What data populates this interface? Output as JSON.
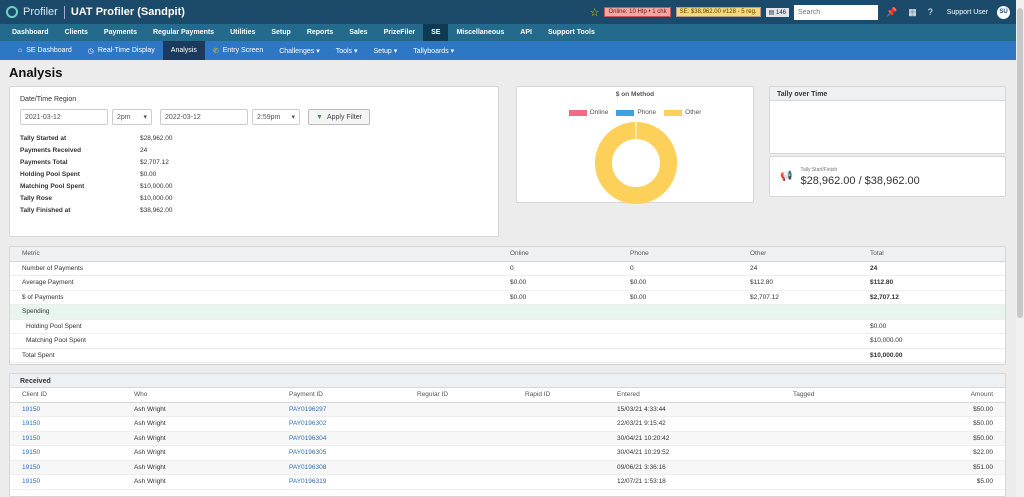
{
  "topbar": {
    "brand": "Profiler",
    "app_title": "UAT Profiler (Sandpit)",
    "online_badge": "Online: 10 Htp • 1 chk",
    "se_badge": "SE: $38,962.00 #128 - 5 reg.",
    "count_badge": "146",
    "search_placeholder": "Search",
    "user_name": "Support User",
    "user_initials": "SU"
  },
  "main_nav": [
    {
      "label": "Dashboard"
    },
    {
      "label": "Clients"
    },
    {
      "label": "Payments"
    },
    {
      "label": "Regular Payments"
    },
    {
      "label": "Utilities"
    },
    {
      "label": "Setup"
    },
    {
      "label": "Reports"
    },
    {
      "label": "Sales"
    },
    {
      "label": "PrizeFiler"
    },
    {
      "label": "SE"
    },
    {
      "label": "Miscellaneous"
    },
    {
      "label": "API"
    },
    {
      "label": "Support Tools"
    }
  ],
  "sub_nav": {
    "se_dashboard": "SE Dashboard",
    "realtime": "Real-Time Display",
    "analysis": "Analysis",
    "entry": "Entry Screen",
    "challenges": "Challenges ▾",
    "tools": "Tools ▾",
    "setup": "Setup ▾",
    "tallyboards": "Tallyboards ▾"
  },
  "page_title": "Analysis",
  "filter": {
    "title": "Date/Time Region",
    "start_date": "2021-03-12",
    "start_time": "2pm",
    "end_date": "2022-03-12",
    "end_time": "2:59pm",
    "apply_label": "Apply Filter"
  },
  "stats": [
    {
      "label": "Tally Started at",
      "value": "$28,962.00"
    },
    {
      "label": "Payments Received",
      "value": "24"
    },
    {
      "label": "Payments Total",
      "value": "$2,707.12"
    },
    {
      "label": "Holding Pool Spent",
      "value": "$0.00"
    },
    {
      "label": "Matching Pool Spent",
      "value": "$10,000.00"
    },
    {
      "label": "Tally Rose",
      "value": "$10,000.00"
    },
    {
      "label": "Tally Finished at",
      "value": "$38,962.00"
    }
  ],
  "chart_data": {
    "type": "pie",
    "title": "$ on Method",
    "categories": [
      "Online",
      "Phone",
      "Other"
    ],
    "values": [
      0,
      0,
      2707.12
    ],
    "colors": [
      "#f06c84",
      "#3ea0e0",
      "#fdd05a"
    ],
    "legend": "top"
  },
  "tally_over_time": {
    "title": "Tally over Time"
  },
  "start_finish": {
    "label": "Tally Start/Finish",
    "value": "$28,962.00 / $38,962.00"
  },
  "metrics": {
    "headers": [
      "Metric",
      "Online",
      "Phone",
      "Other",
      "Total"
    ],
    "rows": [
      [
        "Number of Payments",
        "0",
        "0",
        "24",
        "24"
      ],
      [
        "Average Payment",
        "$0.00",
        "$0.00",
        "$112.80",
        "$112.80"
      ],
      [
        "$ of Payments",
        "$0.00",
        "$0.00",
        "$2,707.12",
        "$2,707.12"
      ]
    ],
    "spending_label": "Spending",
    "spending_rows": [
      [
        "Holding Pool Spent",
        "$0.00"
      ],
      [
        "Matching Pool Spent",
        "$10,000.00"
      ],
      [
        "Total Spent",
        "$10,000.00"
      ]
    ]
  },
  "received": {
    "title": "Received",
    "headers": [
      "Client ID",
      "Who",
      "Payment ID",
      "Regular ID",
      "Rapid ID",
      "Entered",
      "Tagged",
      "Amount"
    ],
    "rows": [
      [
        "19150",
        "Ash Wright",
        "PAY0196297",
        "",
        "",
        "15/03/21 4:33:44",
        "",
        "$50.00"
      ],
      [
        "19150",
        "Ash Wright",
        "PAY0196302",
        "",
        "",
        "22/03/21 9:15:42",
        "",
        "$50.00"
      ],
      [
        "19150",
        "Ash Wright",
        "PAY0196304",
        "",
        "",
        "30/04/21 10:20:42",
        "",
        "$50.00"
      ],
      [
        "19150",
        "Ash Wright",
        "PAY0196305",
        "",
        "",
        "30/04/21 10:29:52",
        "",
        "$22.00"
      ],
      [
        "19150",
        "Ash Wright",
        "PAY0196308",
        "",
        "",
        "09/06/21 3:36:16",
        "",
        "$51.00"
      ],
      [
        "19150",
        "Ash Wright",
        "PAY0196319",
        "",
        "",
        "12/07/21 1:53:18",
        "",
        "$5.00"
      ]
    ]
  }
}
